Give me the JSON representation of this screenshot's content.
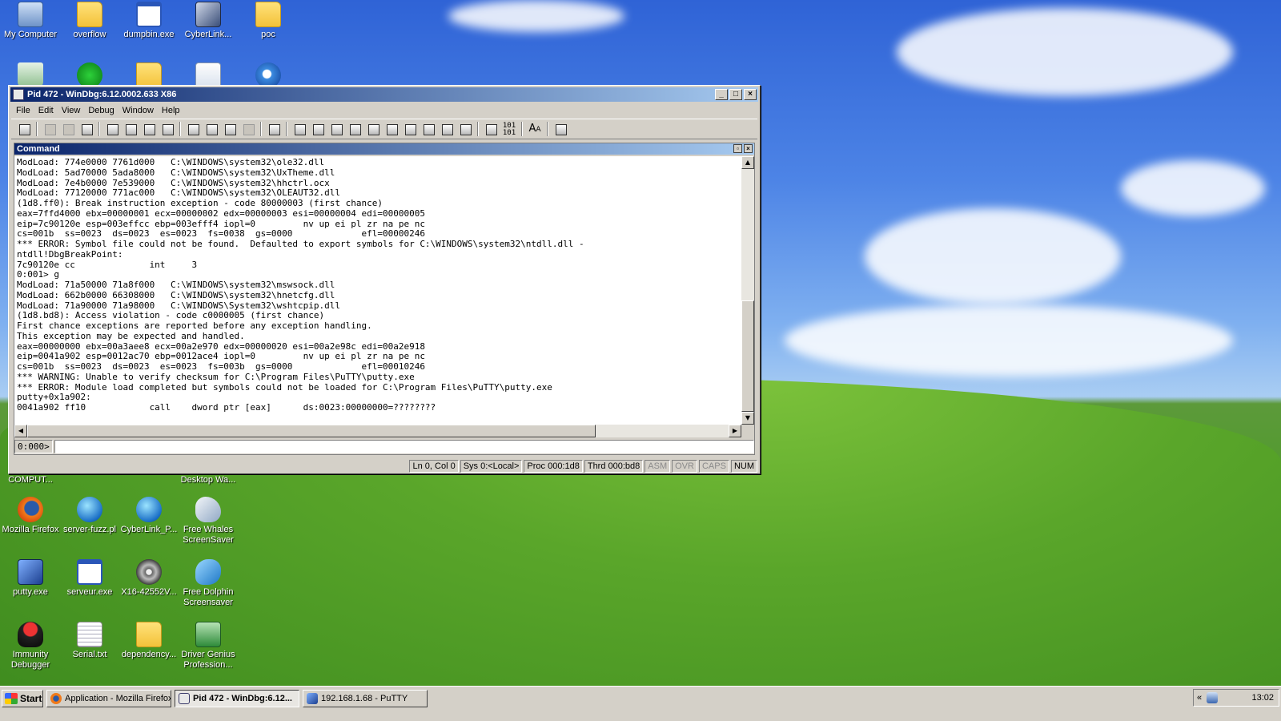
{
  "desktop_icons": [
    {
      "label": "My Computer",
      "icon": "computer-icon"
    },
    {
      "label": "overflow",
      "icon": "folder-icon"
    },
    {
      "label": "dumpbin.exe",
      "icon": "app-window-icon"
    },
    {
      "label": "CyberLink...",
      "icon": "cyberlink-icon"
    },
    {
      "label": "poc",
      "icon": "folder-icon"
    },
    {
      "label": "COMPUT...",
      "icon": "recycle-icon"
    },
    {
      "label": "Desktop Wa...",
      "icon": "document-icon"
    },
    {
      "label": "Mozilla Firefox",
      "icon": "firefox-icon"
    },
    {
      "label": "server-fuzz.pl",
      "icon": "perl-script-icon"
    },
    {
      "label": "CyberLink_P...",
      "icon": "cyberlink-orb-icon"
    },
    {
      "label": "Free Whales ScreenSaver",
      "icon": "whale-icon"
    },
    {
      "label": "putty.exe",
      "icon": "putty-icon"
    },
    {
      "label": "serveur.exe",
      "icon": "app-window-icon"
    },
    {
      "label": "X16-42552V...",
      "icon": "iso-disc-icon"
    },
    {
      "label": "Free Dolphin Screensaver",
      "icon": "dolphin-icon"
    },
    {
      "label": "Immunity Debugger",
      "icon": "immunity-icon"
    },
    {
      "label": "Serial.txt",
      "icon": "text-file-icon"
    },
    {
      "label": "dependency...",
      "icon": "folder-icon"
    },
    {
      "label": "Driver Genius Profession...",
      "icon": "driver-genius-icon"
    }
  ],
  "window": {
    "title": "Pid 472 - WinDbg:6.12.0002.633 X86",
    "menu": [
      "File",
      "Edit",
      "View",
      "Debug",
      "Window",
      "Help"
    ],
    "command_pane_title": "Command",
    "output_lines": [
      "ModLoad: 774e0000 7761d000   C:\\WINDOWS\\system32\\ole32.dll",
      "ModLoad: 5ad70000 5ada8000   C:\\WINDOWS\\system32\\UxTheme.dll",
      "ModLoad: 7e4b0000 7e539000   C:\\WINDOWS\\system32\\hhctrl.ocx",
      "ModLoad: 77120000 771ac000   C:\\WINDOWS\\system32\\OLEAUT32.dll",
      "(1d8.ff0): Break instruction exception - code 80000003 (first chance)",
      "eax=7ffd4000 ebx=00000001 ecx=00000002 edx=00000003 esi=00000004 edi=00000005",
      "eip=7c90120e esp=003effcc ebp=003efff4 iopl=0         nv up ei pl zr na pe nc",
      "cs=001b  ss=0023  ds=0023  es=0023  fs=0038  gs=0000             efl=00000246",
      "*** ERROR: Symbol file could not be found.  Defaulted to export symbols for C:\\WINDOWS\\system32\\ntdll.dll -",
      "ntdll!DbgBreakPoint:",
      "7c90120e cc              int     3",
      "0:001> g",
      "ModLoad: 71a50000 71a8f000   C:\\WINDOWS\\system32\\mswsock.dll",
      "ModLoad: 662b0000 66308000   C:\\WINDOWS\\system32\\hnetcfg.dll",
      "ModLoad: 71a90000 71a98000   C:\\WINDOWS\\System32\\wshtcpip.dll",
      "(1d8.bd8): Access violation - code c0000005 (first chance)",
      "First chance exceptions are reported before any exception handling.",
      "This exception may be expected and handled.",
      "eax=00000000 ebx=00a3aee8 ecx=00a2e970 edx=00000020 esi=00a2e98c edi=00a2e918",
      "eip=0041a902 esp=0012ac70 ebp=0012ace4 iopl=0         nv up ei pl zr na pe nc",
      "cs=001b  ss=0023  ds=0023  es=0023  fs=003b  gs=0000             efl=00010246",
      "*** WARNING: Unable to verify checksum for C:\\Program Files\\PuTTY\\putty.exe",
      "*** ERROR: Module load completed but symbols could not be loaded for C:\\Program Files\\PuTTY\\putty.exe",
      "putty+0x1a902:",
      "0041a902 ff10            call    dword ptr [eax]      ds:0023:00000000=????????"
    ],
    "prompt": "0:000>",
    "status": {
      "position": "Ln 0, Col 0",
      "sys": "Sys 0:<Local>",
      "proc": "Proc 000:1d8",
      "thrd": "Thrd 000:bd8",
      "asm": "ASM",
      "ovr": "OVR",
      "caps": "CAPS",
      "num": "NUM"
    }
  },
  "taskbar": {
    "start_label": "Start",
    "tasks": [
      {
        "label": "Application - Mozilla Firefox",
        "icon": "firefox-icon"
      },
      {
        "label": "Pid 472 - WinDbg:6.12...",
        "icon": "windbg-icon"
      },
      {
        "label": "192.168.1.68 - PuTTY",
        "icon": "putty-icon"
      }
    ],
    "tray_expand": "«",
    "clock": "13:02"
  }
}
